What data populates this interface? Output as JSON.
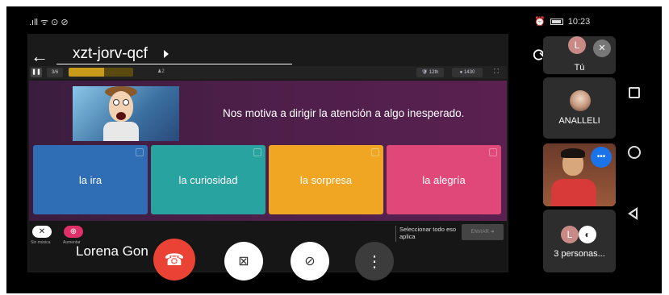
{
  "status_bar": {
    "left_icons": ".ıll ᯤ ⊙ ⊘",
    "alarm_icon": "alarm-icon",
    "time": "10:23"
  },
  "meeting": {
    "code": "xzt-jorv-qcf"
  },
  "quiz": {
    "question_counter": "3/6",
    "progress_fraction": 0.55,
    "small_stat": "♟2",
    "rank": "12th",
    "score": "1430",
    "question": "Nos motiva a dirigir la atención a algo inesperado.",
    "answers": [
      {
        "label": "la ira",
        "color": "#2f6db5"
      },
      {
        "label": "la curiosidad",
        "color": "#28a3a0"
      },
      {
        "label": "la sorpresa",
        "color": "#f0a623"
      },
      {
        "label": "la alegría",
        "color": "#e0487a"
      }
    ],
    "left_tool_a_label": "Sin música",
    "left_tool_b_label": "Aumentar",
    "select_all_text": "Seleccionar todo eso aplica",
    "send_label": "ENVIAR ➜"
  },
  "presenter": {
    "name": "Lorena Gon"
  },
  "participants": [
    {
      "label": "Tú",
      "initial": "L",
      "muted": true
    },
    {
      "label": "ANALLELI",
      "muted": false
    },
    {
      "label": "",
      "speaking": true
    },
    {
      "label": "3 personas...",
      "initial": "L"
    }
  ],
  "controls": {
    "end_call_icon": "phone-hangup-icon",
    "camera_icon": "camera-off-icon",
    "mic_icon": "mic-off-icon",
    "more_icon": "more-vert-icon"
  }
}
